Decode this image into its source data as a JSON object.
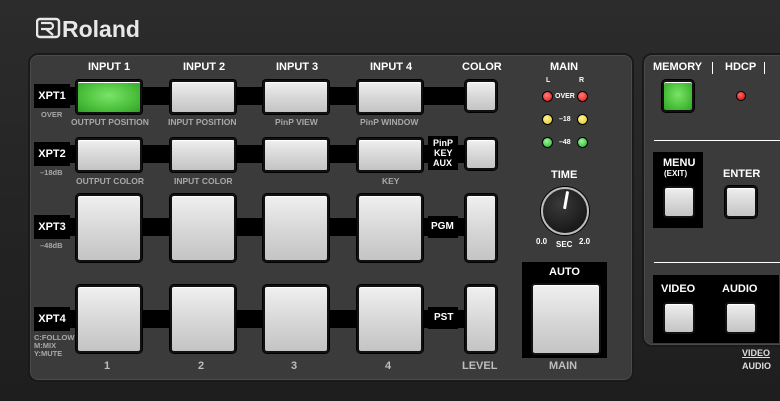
{
  "brand": {
    "name": "Roland"
  },
  "columns": {
    "input1": "INPUT 1",
    "input2": "INPUT 2",
    "input3": "INPUT 3",
    "input4": "INPUT 4",
    "color": "COLOR",
    "main": "MAIN"
  },
  "rows": {
    "xpt1": {
      "label": "XPT1",
      "sub": "OVER"
    },
    "xpt2": {
      "label": "XPT2",
      "sub": "–18dB"
    },
    "xpt3": {
      "label": "XPT3",
      "sub": "–48dB"
    },
    "xpt4": {
      "label": "XPT4",
      "sub1": "C:FOLLOW",
      "sub2": "M:MIX",
      "sub3": "Y:MUTE"
    }
  },
  "sublabels_row1": [
    "OUTPUT POSITION",
    "INPUT POSITION",
    "PinP VIEW",
    "PinP WINDOW"
  ],
  "sublabels_row2": [
    "OUTPUT COLOR",
    "INPUT COLOR",
    "",
    "KEY"
  ],
  "pinp_key_aux": [
    "PinP",
    "KEY",
    "AUX"
  ],
  "pgm": "PGM",
  "pst": "PST",
  "level": "LEVEL",
  "numbers": [
    "1",
    "2",
    "3",
    "4"
  ],
  "meter": {
    "l": "L",
    "r": "R",
    "over": "OVER",
    "m18": "–18",
    "m48": "–48"
  },
  "time": {
    "label": "TIME",
    "min": "0.0",
    "sec": "SEC",
    "max": "2.0"
  },
  "auto": {
    "label": "AUTO",
    "main": "MAIN"
  },
  "right": {
    "memory": "MEMORY",
    "hdcp": "HDCP",
    "menu": "MENU",
    "menu_sub": "(EXIT)",
    "enter": "ENTER",
    "video": "VIDEO",
    "audio": "AUDIO",
    "video_audio_1": "VIDEO",
    "video_audio_2": "AUDIO"
  },
  "colors": {
    "accent_green": "#4ec43e",
    "led_red": "#e01616",
    "led_yellow": "#e3c21a",
    "led_green": "#23b02a"
  }
}
